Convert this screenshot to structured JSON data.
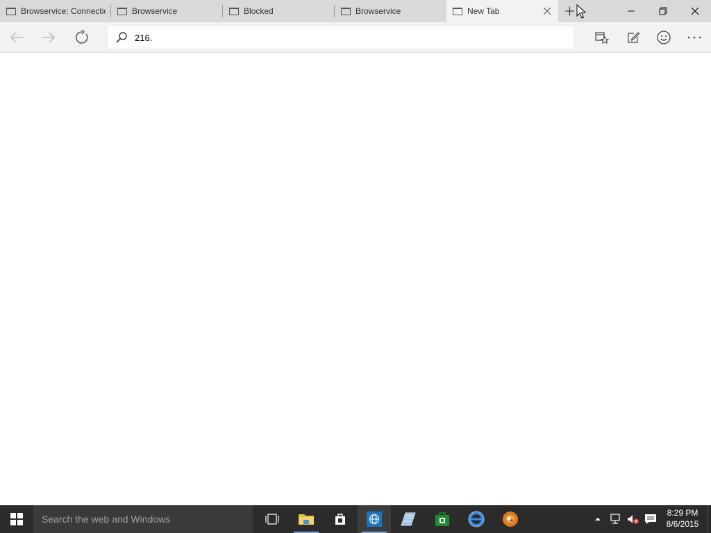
{
  "browser": {
    "tabs": [
      {
        "title": "Browservice: Connectio",
        "active": false
      },
      {
        "title": "Browservice",
        "active": false
      },
      {
        "title": "Blocked",
        "active": false
      },
      {
        "title": "Browservice",
        "active": false
      },
      {
        "title": "New Tab",
        "active": true
      }
    ],
    "address": {
      "value": "216.",
      "placeholder": ""
    }
  },
  "taskbar": {
    "search_placeholder": "Search the web and Windows",
    "clock": {
      "time": "8:29 PM",
      "date": "8/6/2015"
    }
  },
  "colors": {
    "tabstrip": "#d9d9d9",
    "navbar": "#f2f2f2",
    "taskbar": "#2b2b2b",
    "edge_blue": "#1e73be",
    "store_green": "#1a8f2c"
  },
  "icons": {
    "back": "arrow-left-icon",
    "forward": "arrow-right-icon",
    "refresh": "refresh-icon",
    "reading_list": "hub-icon",
    "web_note": "web-note-icon",
    "feedback": "smiley-icon",
    "more": "more-icon"
  }
}
